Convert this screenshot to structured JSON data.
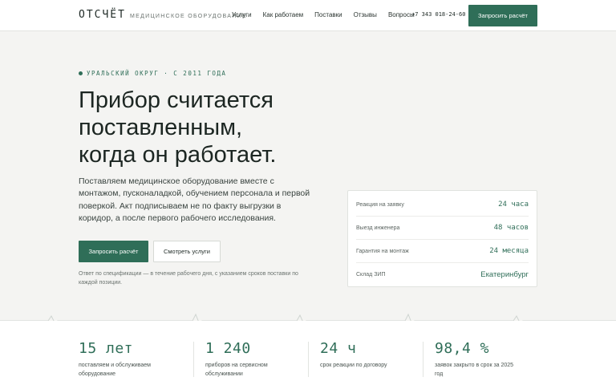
{
  "header": {
    "logo": "ОТСЧЁТ",
    "logo_sub": "МЕДИЦИНСКОЕ ОБОРУДОВАНИЕ",
    "nav": [
      "Услуги",
      "Как работаем",
      "Поставки",
      "Отзывы",
      "Вопросы"
    ],
    "phone": "+7 343 018-24-60",
    "cta": "Запросить расчёт"
  },
  "hero": {
    "eyebrow": "УРАЛЬСКИЙ ОКРУГ · С 2011 ГОДА",
    "headline": [
      "Прибор считается",
      "поставленным,",
      "когда он работает."
    ],
    "lead": "Поставляем медицинское оборудование вместе с монтажом, пусконаладкой, обучением персонала и первой поверкой. Акт подписываем не по факту выгрузки в коридор, а после первого рабочего исследования.",
    "primary_button": "Запросить расчёт",
    "secondary_button": "Смотреть услуги",
    "note": "Ответ по спецификации — в течение рабочего дня, с указанием сроков поставки по каждой позиции."
  },
  "card": {
    "rows": [
      {
        "label": "Реакция на заявку",
        "value": "24 часа"
      },
      {
        "label": "Выезд инженера",
        "value": "48 часов"
      },
      {
        "label": "Гарантия на монтаж",
        "value": "24 месяца"
      },
      {
        "label": "Склад ЗИП",
        "value": "Екатеринбург"
      }
    ]
  },
  "stats": [
    {
      "value": "15 лет",
      "label": "поставляем и обслуживаем оборудование"
    },
    {
      "value": "1 240",
      "label": "приборов на сервисном обслуживании"
    },
    {
      "value": "24 ч",
      "label": "срок реакции по договору"
    },
    {
      "value": "98,4 %",
      "label": "заявок закрыто в срок за 2025 год"
    }
  ],
  "colors": {
    "accent": "#2f6e58",
    "background": "#f4f4f2",
    "surface": "#ffffff"
  }
}
